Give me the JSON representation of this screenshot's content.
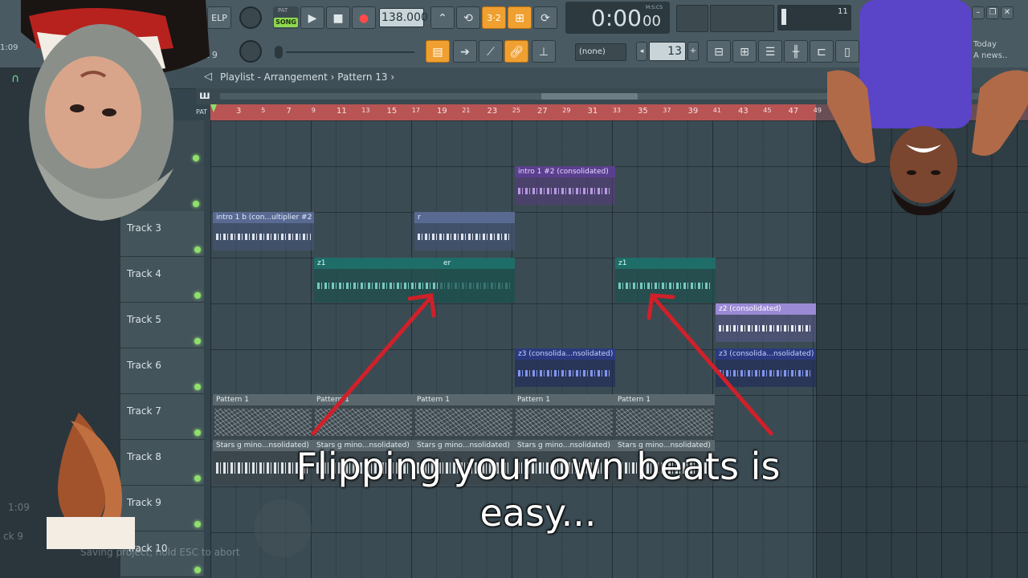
{
  "toolbar": {
    "help_label": "ELP",
    "pat_label": "PAT",
    "song_label": "SONG",
    "tempo": "138.000",
    "time": "0:00",
    "time_sub": "00",
    "time_unit": "M:S:CS",
    "cpu_value": "11",
    "pattern_select": "(none)",
    "step_value": "13",
    "news_label": "Today",
    "news_text": "A news..",
    "left_clock": "1:09",
    "left_track_label": "k 9"
  },
  "playlist": {
    "title": "Playlist - Arrangement",
    "separator": "›",
    "pattern": "Pattern 13",
    "ruler": [
      "3",
      "5",
      "7",
      "9",
      "11",
      "13",
      "15",
      "17",
      "19",
      "21",
      "23",
      "25",
      "27",
      "29",
      "31",
      "33",
      "35",
      "37",
      "39",
      "41",
      "43",
      "45",
      "47",
      "49"
    ]
  },
  "tracks": [
    {
      "name": "Track 3"
    },
    {
      "name": "Track 4"
    },
    {
      "name": "Track 5"
    },
    {
      "name": "Track 6"
    },
    {
      "name": "Track 7"
    },
    {
      "name": "Track 8"
    },
    {
      "name": "Track 9"
    },
    {
      "name": "Track 10"
    }
  ],
  "clips": {
    "intro1_2": "intro 1 #2 (consolidated)",
    "intro1b": "intro 1 b (con...ultiplier #2",
    "short_r": "r",
    "z1": "z1",
    "short_er": "er",
    "z1_second": "z1",
    "z2": "z2 (consolidated)",
    "z3": "z3 (consolida...nsolidated)",
    "z3_b": "z3 (consolida...nsolidated)",
    "pattern1": "Pattern 1",
    "stars": "Stars g mino...nsolidated)"
  },
  "status": {
    "saving": "Saving project, hold ESC to abort",
    "clock": "1:09",
    "track_label": "ck 9"
  },
  "caption": {
    "line1": "Flipping your own beats is",
    "line2": "easy..."
  },
  "colors": {
    "accent": "#f0a030",
    "ruler": "#b85454",
    "arrow": "#d0202a",
    "led": "#8ee06a"
  }
}
